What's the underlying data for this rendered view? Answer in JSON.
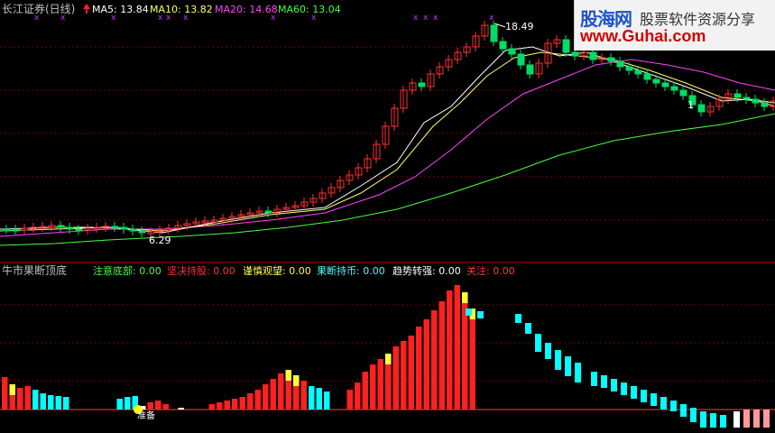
{
  "main_chart": {
    "title": "长江证券(日线)",
    "ma_labels": [
      {
        "text": "MA5: 13.84",
        "color": "#ffffff"
      },
      {
        "text": "MA10: 13.82",
        "color": "#ffff66"
      },
      {
        "text": "MA20: 14.68",
        "color": "#ff44ff"
      },
      {
        "text": "MA60: 13.04",
        "color": "#44ff44"
      }
    ],
    "high_label": "18.49",
    "low_label": "6.29"
  },
  "indicator": {
    "title": "牛市果断顶底",
    "items": [
      {
        "text": "注意底部: 0.00",
        "color": "#44ff44"
      },
      {
        "text": "坚决持股: 0.00",
        "color": "#ff3333"
      },
      {
        "text": "谨慎观望: 0.00",
        "color": "#ffff44"
      },
      {
        "text": "果断持币: 0.00",
        "color": "#44ffff"
      },
      {
        "text": "趋势转强: 0.00",
        "color": "#ffffff"
      },
      {
        "text": "关注: 0.00",
        "color": "#ff3333"
      }
    ],
    "bottom_marker": "准备"
  },
  "watermark": {
    "brand": "股海网",
    "slogan": "股票软件资源分享",
    "url": "www.Guhai.com"
  },
  "colors": {
    "up": "#ff3030",
    "down": "#00ffff",
    "grid": "#8b0000",
    "panel_border": "#c80000"
  },
  "bars": [
    {
      "h": 36,
      "c": "red",
      "y": false
    },
    {
      "h": 28,
      "c": "red",
      "y": true
    },
    {
      "h": 24,
      "c": "red",
      "y": false
    },
    {
      "h": 26,
      "c": "red",
      "y": false
    },
    {
      "h": 22,
      "c": "cyan"
    },
    {
      "h": 18,
      "c": "cyan"
    },
    {
      "h": 16,
      "c": "cyan"
    },
    {
      "h": 15,
      "c": "cyan"
    },
    {
      "h": 14,
      "c": "cyan"
    },
    {
      "h": 0,
      "c": "none"
    },
    {
      "h": 0,
      "c": "none"
    },
    {
      "h": 0,
      "c": "none"
    },
    {
      "h": 0,
      "c": "none"
    },
    {
      "h": 0,
      "c": "none"
    },
    {
      "h": 0,
      "c": "none"
    },
    {
      "h": 12,
      "c": "cyan"
    },
    {
      "h": 14,
      "c": "cyan"
    },
    {
      "h": 15,
      "c": "cyan"
    },
    {
      "h": 4,
      "c": "white"
    },
    {
      "h": 8,
      "c": "red"
    },
    {
      "h": 10,
      "c": "red"
    },
    {
      "h": 6,
      "c": "red"
    },
    {
      "h": 0,
      "c": "none"
    },
    {
      "h": 2,
      "c": "white"
    },
    {
      "h": 0,
      "c": "none"
    },
    {
      "h": 0,
      "c": "none"
    },
    {
      "h": 0,
      "c": "none"
    },
    {
      "h": 6,
      "c": "red"
    },
    {
      "h": 8,
      "c": "red"
    },
    {
      "h": 10,
      "c": "red"
    },
    {
      "h": 12,
      "c": "red"
    },
    {
      "h": 14,
      "c": "red"
    },
    {
      "h": 18,
      "c": "red"
    },
    {
      "h": 22,
      "c": "red"
    },
    {
      "h": 28,
      "c": "red"
    },
    {
      "h": 34,
      "c": "red"
    },
    {
      "h": 40,
      "c": "red"
    },
    {
      "h": 44,
      "c": "red",
      "y": true
    },
    {
      "h": 38,
      "c": "red",
      "y": true
    },
    {
      "h": 32,
      "c": "red"
    },
    {
      "h": 26,
      "c": "cyan"
    },
    {
      "h": 24,
      "c": "cyan"
    },
    {
      "h": 20,
      "c": "cyan"
    },
    {
      "h": 0,
      "c": "none"
    },
    {
      "h": 0,
      "c": "none"
    },
    {
      "h": 22,
      "c": "red"
    },
    {
      "h": 30,
      "c": "red"
    },
    {
      "h": 42,
      "c": "red"
    },
    {
      "h": 50,
      "c": "red"
    },
    {
      "h": 56,
      "c": "red"
    },
    {
      "h": 62,
      "c": "red",
      "y": true
    },
    {
      "h": 70,
      "c": "red"
    },
    {
      "h": 76,
      "c": "red"
    },
    {
      "h": 82,
      "c": "red"
    },
    {
      "h": 92,
      "c": "red"
    },
    {
      "h": 100,
      "c": "red"
    },
    {
      "h": 110,
      "c": "red"
    },
    {
      "h": 120,
      "c": "red"
    },
    {
      "h": 132,
      "c": "red"
    },
    {
      "h": 138,
      "c": "red"
    },
    {
      "h": 130,
      "c": "red",
      "y": true
    },
    {
      "h": 112,
      "c": "red",
      "y": true
    },
    {
      "h": 0,
      "c": "none"
    },
    {
      "h": 0,
      "c": "none"
    },
    {
      "h": 0,
      "c": "none"
    },
    {
      "h": 0,
      "c": "none"
    },
    {
      "h": 0,
      "c": "none"
    },
    {
      "h": 0,
      "c": "none"
    },
    {
      "h": 0,
      "c": "none"
    },
    {
      "h": 0,
      "c": "none"
    },
    {
      "h": 0,
      "c": "none"
    },
    {
      "h": 0,
      "c": "none"
    },
    {
      "h": 0,
      "c": "none"
    },
    {
      "h": 0,
      "c": "none"
    },
    {
      "h": 0,
      "c": "none"
    },
    {
      "h": 0,
      "c": "none"
    },
    {
      "h": 0,
      "c": "none"
    },
    {
      "h": 0,
      "c": "none"
    },
    {
      "h": 0,
      "c": "none"
    },
    {
      "h": 0,
      "c": "none"
    }
  ]
}
